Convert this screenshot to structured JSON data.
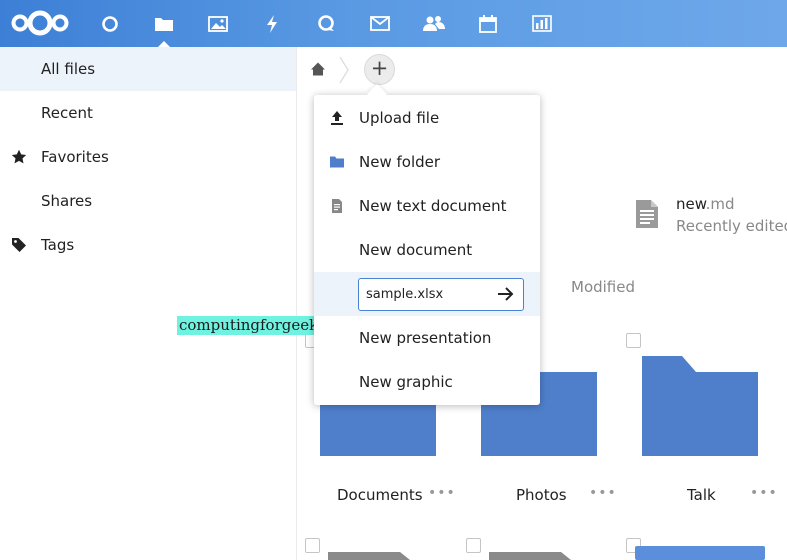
{
  "header": {
    "apps": [
      {
        "icon": "dashboard-icon"
      },
      {
        "icon": "files-icon",
        "active": true
      },
      {
        "icon": "photos-icon"
      },
      {
        "icon": "activity-icon"
      },
      {
        "icon": "talk-icon"
      },
      {
        "icon": "mail-icon"
      },
      {
        "icon": "contacts-icon"
      },
      {
        "icon": "calendar-icon"
      },
      {
        "icon": "analytics-icon"
      }
    ]
  },
  "sidebar": {
    "items": [
      {
        "label": "All files",
        "icon": "",
        "active": true
      },
      {
        "label": "Recent",
        "icon": ""
      },
      {
        "label": "Favorites",
        "icon": "star-icon"
      },
      {
        "label": "Shares",
        "icon": ""
      },
      {
        "label": "Tags",
        "icon": "tag-icon"
      }
    ]
  },
  "recent": {
    "name": "new",
    "ext": ".md",
    "subtitle": "Recently edited"
  },
  "columns": {
    "modified": "Modified"
  },
  "files": [
    {
      "name": "Documents"
    },
    {
      "name": "Photos"
    },
    {
      "name": "Talk"
    }
  ],
  "menu": {
    "upload": "Upload file",
    "new_folder": "New folder",
    "new_text": "New text document",
    "new_document": "New document",
    "input_value": "sample.xlsx",
    "new_presentation": "New presentation",
    "new_graphic": "New graphic"
  },
  "more_label": "•••",
  "add_label": "+",
  "watermark": "computingforgeeks.com",
  "colors": {
    "header_start": "#3d7fd6",
    "header_end": "#6ea8ea",
    "folder": "#4f7fcb",
    "highlight": "#edf3fb",
    "watermark_bg": "#6ff2e0"
  }
}
